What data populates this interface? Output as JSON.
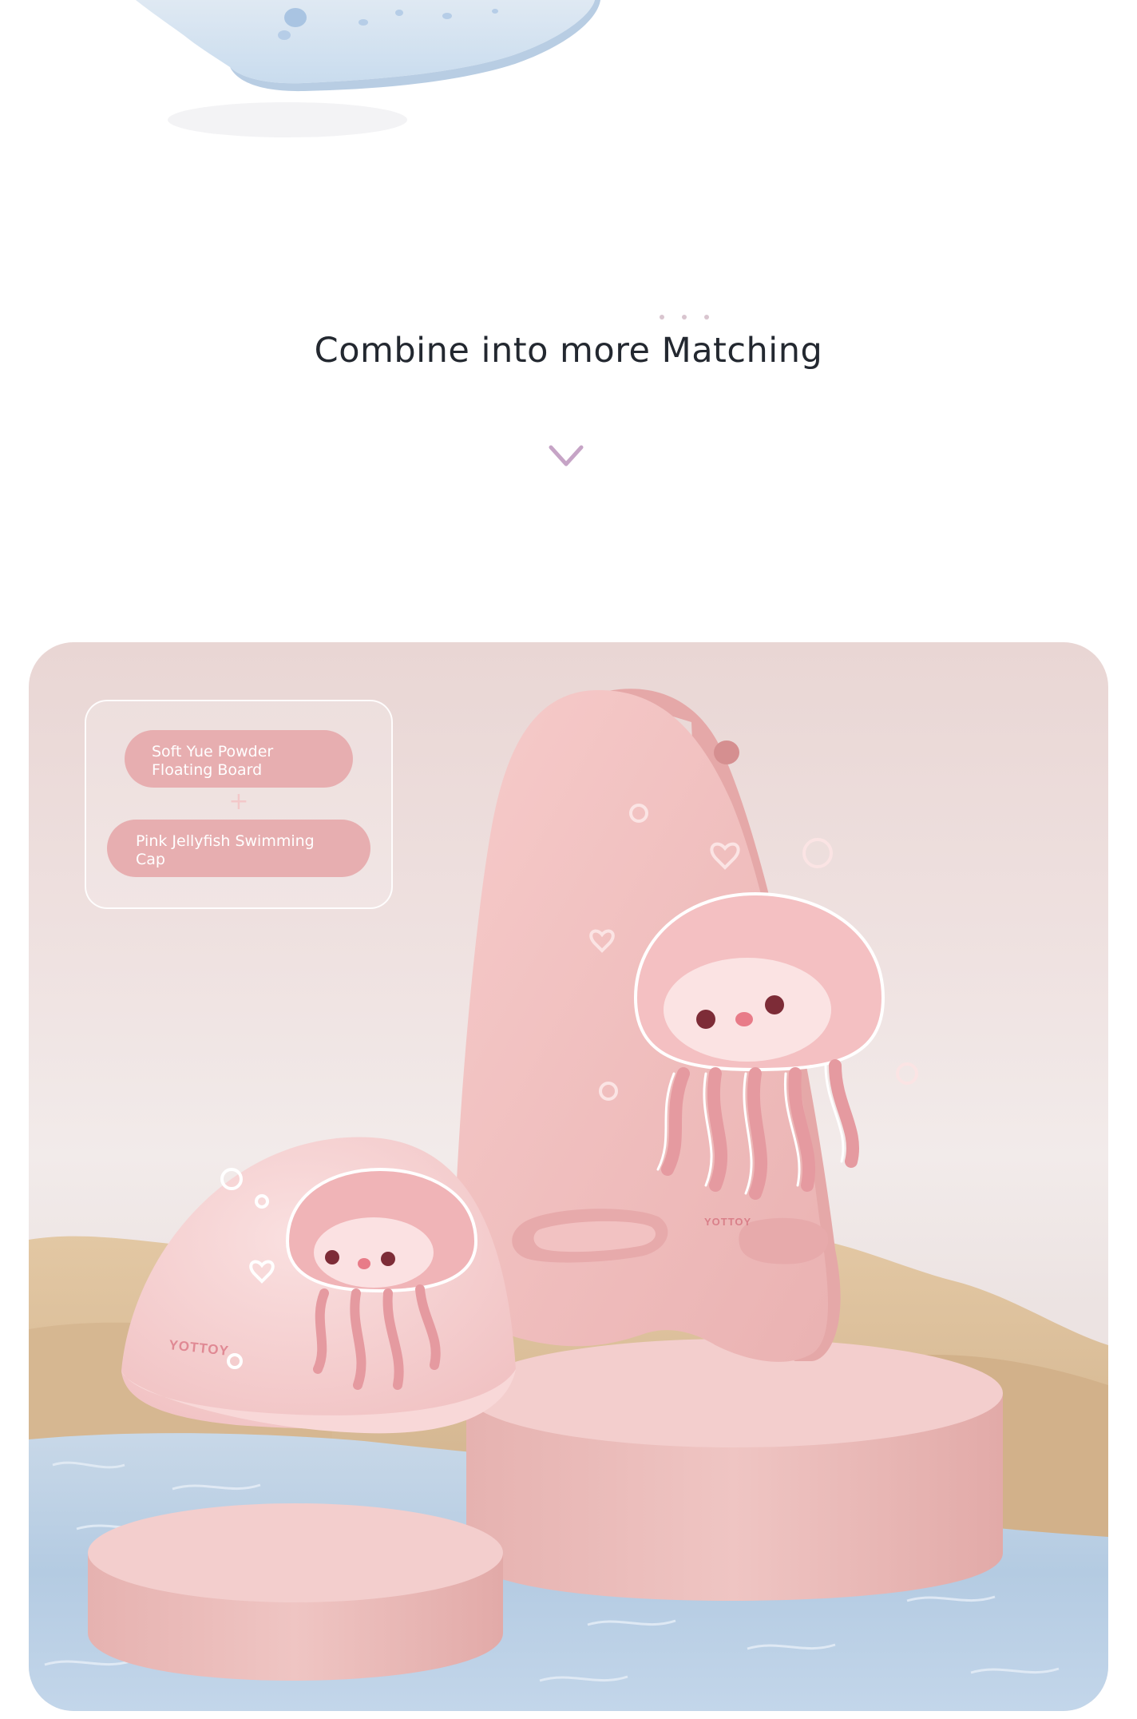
{
  "section": {
    "heading": "Combine into more Matching"
  },
  "icons": {
    "decor_dots": "dots-icon",
    "scroll_hint": "chevron-down-icon",
    "combine": "plus-icon"
  },
  "combo": {
    "item_1": "Soft Yue Powder\nFloating Board",
    "plus": "+",
    "item_2": "Pink Jellyfish Swimming\nCap"
  },
  "product": {
    "brand_board": "YOTTOY",
    "brand_cap": "YOTTOY"
  },
  "colors": {
    "accent_pink": "#e7aeb0",
    "heading_text": "#232830",
    "chevron": "#c6a4c6",
    "board_pink": "#f0bcbc",
    "pedestal_pink": "#e8b7b5",
    "water_blue": "#b9cfe4",
    "sand": "#d9bb96"
  }
}
